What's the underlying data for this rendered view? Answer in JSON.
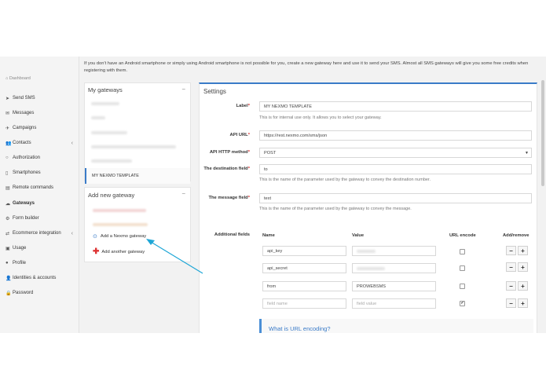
{
  "intro_text": "If you don't have an Android smartphone or simply using Android smartphone is not possible for you, create a new gateway here and use it to send your SMS. Almost all SMS gateways will give you some free credits when registering with them.",
  "sidebar": {
    "dashboard": "Dashboard",
    "items": [
      {
        "label": "Send SMS",
        "icon": "send-icon",
        "glyph": "➤"
      },
      {
        "label": "Messages",
        "icon": "envelope-icon",
        "glyph": "✉"
      },
      {
        "label": "Campaigns",
        "icon": "megaphone-icon",
        "glyph": "✈"
      },
      {
        "label": "Contacts",
        "icon": "users-icon",
        "glyph": "👥"
      },
      {
        "label": "Authorization",
        "icon": "check-circle-icon",
        "glyph": "○"
      },
      {
        "label": "Smartphones",
        "icon": "phone-icon",
        "glyph": "▯"
      },
      {
        "label": "Remote commands",
        "icon": "terminal-icon",
        "glyph": "▤"
      },
      {
        "label": "Gateways",
        "icon": "cloud-icon",
        "glyph": "☁"
      },
      {
        "label": "Form builder",
        "icon": "gears-icon",
        "glyph": "⚙"
      },
      {
        "label": "Ecommerce integration",
        "icon": "cart-icon",
        "glyph": "⇄"
      },
      {
        "label": "Usage",
        "icon": "chart-icon",
        "glyph": "▣"
      },
      {
        "label": "Profile",
        "icon": "user-icon",
        "glyph": "●"
      },
      {
        "label": "Identities & accounts",
        "icon": "id-card-icon",
        "glyph": "👤"
      },
      {
        "label": "Password",
        "icon": "lock-icon",
        "glyph": "🔒"
      }
    ]
  },
  "my_gateways": {
    "title": "My gateways",
    "collapse": "−",
    "active_item": "MY NEXMO TEMPLATE"
  },
  "add_gateway": {
    "title": "Add new gateway",
    "collapse": "−",
    "nexmo_label": "Add a Nexmo gateway",
    "another_label": "Add another gateway"
  },
  "settings": {
    "title": "Settings",
    "label_label": "Label",
    "label_value": "MY NEXMO TEMPLATE",
    "label_hint": "This is for internal use only. It allows you to select your gateway.",
    "api_url_label": "API URL",
    "api_url_value": "https://rest.nexmo.com/sms/json",
    "method_label": "API HTTP method",
    "method_value": "POST",
    "dest_label": "The destination field",
    "dest_value": "to",
    "dest_hint": "This is the name of the parameter used by the gateway to convey the destination number.",
    "msg_label": "The message field",
    "msg_value": "text",
    "msg_hint": "This is the name of the parameter used by the gateway to convey the message.",
    "additional_label": "Additional fields",
    "col_name": "Name",
    "col_value": "Value",
    "col_encode": "URL encode",
    "col_addremove": "Add/remove",
    "rows": [
      {
        "name": "api_key",
        "value": "",
        "encode": false
      },
      {
        "name": "api_secret",
        "value": "",
        "encode": false
      },
      {
        "name": "from",
        "value": "PROWEBSMS",
        "encode": false
      },
      {
        "name_placeholder": "field name",
        "value_placeholder": "field value",
        "encode": true
      }
    ],
    "minus": "−",
    "plus": "+",
    "info_title": "What is URL encoding?"
  },
  "accent_color": "#3a7bc8",
  "arrow_color": "#1ea6d6"
}
